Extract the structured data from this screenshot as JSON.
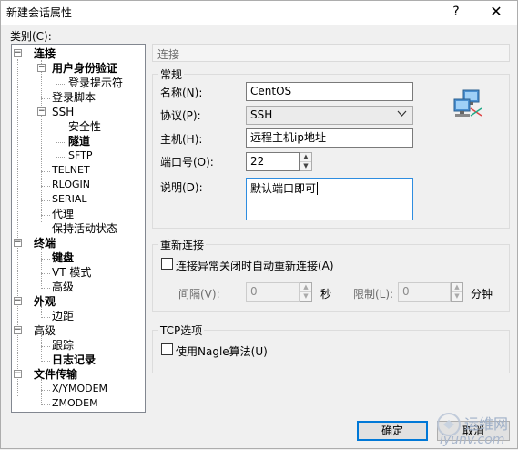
{
  "window": {
    "title": "新建会话属性",
    "help_label": "?",
    "close_label": "✕"
  },
  "category_label": "类别(C):",
  "tree": {
    "connection": "连接",
    "auth": "用户身份验证",
    "login_prompt": "登录提示符",
    "login_script": "登录脚本",
    "ssh": "SSH",
    "security": "安全性",
    "tunnel": "隧道",
    "sftp": "SFTP",
    "telnet": "TELNET",
    "rlogin": "RLOGIN",
    "serial": "SERIAL",
    "proxy": "代理",
    "keepalive": "保持活动状态",
    "terminal": "终端",
    "keyboard": "键盘",
    "vt_mode": "VT 模式",
    "advanced1": "高级",
    "appearance": "外观",
    "margin": "边距",
    "advanced": "高级",
    "trace": "跟踪",
    "log": "日志记录",
    "file_transfer": "文件传输",
    "xymodem": "X/YMODEM",
    "zmodem": "ZMODEM"
  },
  "section_header": "连接",
  "general": {
    "title": "常规",
    "name_label": "名称(N):",
    "name_value": "CentOS",
    "protocol_label": "协议(P):",
    "protocol_value": "SSH",
    "host_label": "主机(H):",
    "host_value": "远程主机ip地址",
    "port_label": "端口号(O):",
    "port_value": "22",
    "desc_label": "说明(D):",
    "desc_value": "默认端口即可"
  },
  "reconnect": {
    "title": "重新连接",
    "auto_label": "连接异常关闭时自动重新连接(A)",
    "interval_label": "间隔(V):",
    "interval_value": "0",
    "seconds_label": "秒",
    "limit_label": "限制(L):",
    "limit_value": "0",
    "minutes_label": "分钟"
  },
  "tcp": {
    "title": "TCP选项",
    "nagle_label": "使用Nagle算法(U)"
  },
  "buttons": {
    "ok": "确定",
    "cancel": "取消"
  },
  "watermark": {
    "cn": "运维网",
    "en": "iyunv.com"
  },
  "icons": {
    "expanded": "−",
    "network": "network-computers-icon"
  },
  "colors": {
    "accent": "#0078d7",
    "focus_border": "#2e8de0"
  }
}
